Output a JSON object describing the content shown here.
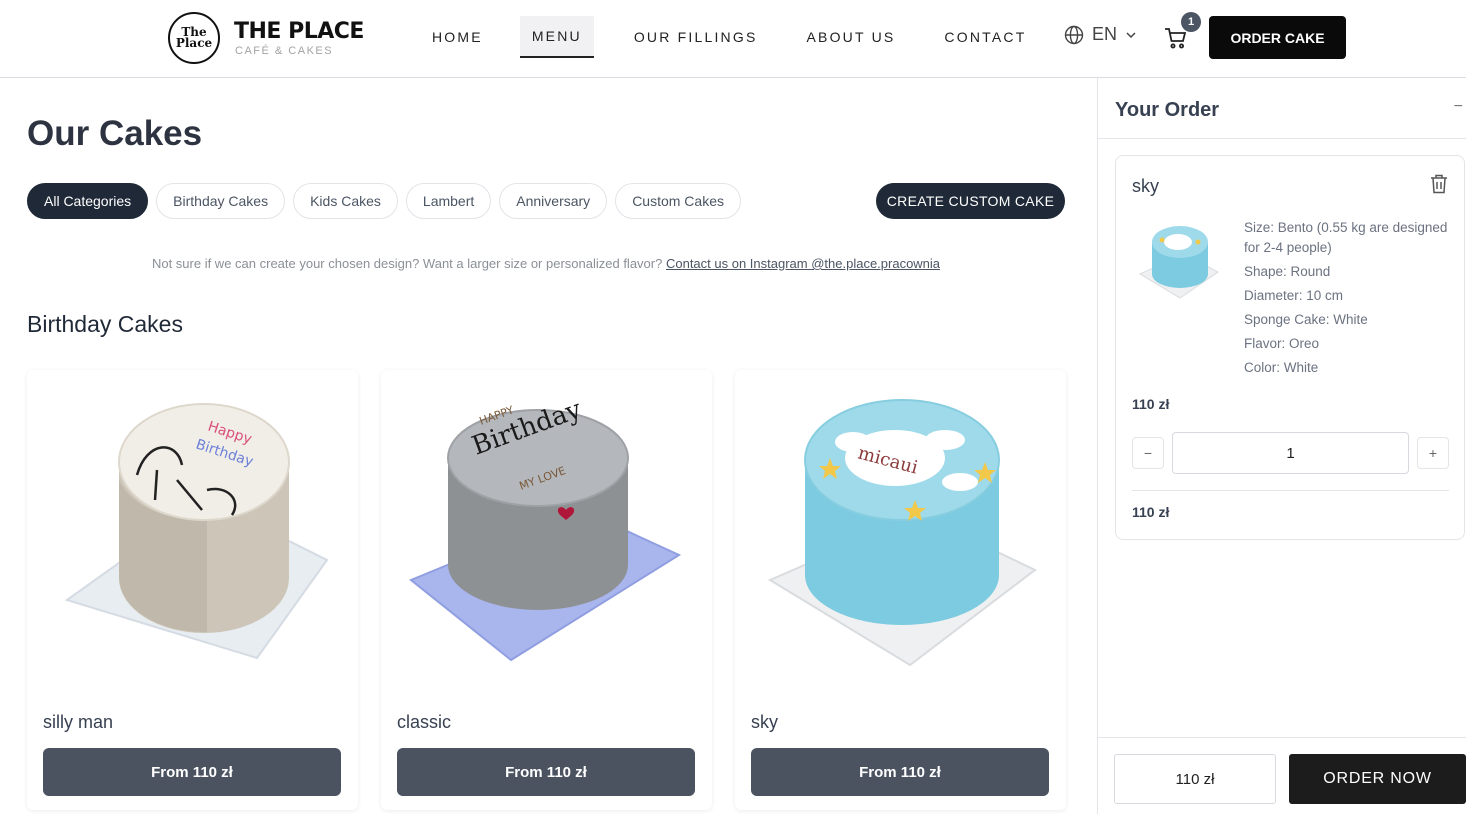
{
  "brand": {
    "badge_line1": "The",
    "badge_line2": "Place",
    "title": "THE PLACE",
    "subtitle": "CAFÉ & CAKES"
  },
  "nav": {
    "items": [
      {
        "label": "HOME"
      },
      {
        "label": "MENU",
        "active": true
      },
      {
        "label": "OUR FILLINGS"
      },
      {
        "label": "ABOUT US"
      },
      {
        "label": "CONTACT"
      }
    ],
    "language": "EN",
    "cart_count": "1",
    "order_button": "ORDER CAKE"
  },
  "main": {
    "title": "Our Cakes",
    "categories": [
      "All Categories",
      "Birthday Cakes",
      "Kids Cakes",
      "Lambert",
      "Anniversary",
      "Custom Cakes"
    ],
    "active_category": "All Categories",
    "custom_button": "CREATE CUSTOM CAKE",
    "notice_text": "Not sure if we can create your chosen design? Want a larger size or personalized flavor?",
    "notice_link": "Contact us on Instagram @the.place.pracownia",
    "section_title": "Birthday Cakes",
    "products": [
      {
        "name": "silly man",
        "price": "From 110 zł"
      },
      {
        "name": "classic",
        "price": "From 110 zł"
      },
      {
        "name": "sky",
        "price": "From 110 zł"
      }
    ]
  },
  "order": {
    "title": "Your Order",
    "minimize": "−",
    "item": {
      "name": "sky",
      "details": [
        "Size: Bento (0.55 kg are designed for 2-4 people)",
        "Shape: Round",
        "Diameter: 10 cm",
        "Sponge Cake: White",
        "Flavor: Oreo",
        "Color: White"
      ],
      "price": "110 zł",
      "quantity": "1",
      "minus": "−",
      "plus": "+",
      "subtotal": "110 zł"
    },
    "total": "110 zł",
    "order_button": "ORDER NOW"
  },
  "colors": {
    "primary_dark": "#1f2937",
    "price_button": "#4b5260",
    "cake_blue": "#7ccbe0"
  }
}
